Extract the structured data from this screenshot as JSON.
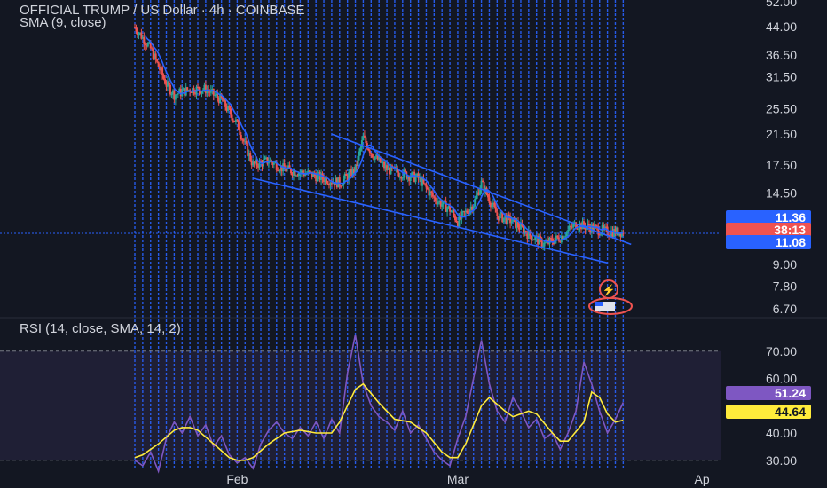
{
  "header": {
    "title": "OFFICIAL TRUMP / US Dollar · 4h · COINBASE",
    "indicator": "SMA (9, close)",
    "rsi_label": "RSI (14, close, SMA, 14, 2)"
  },
  "badges": {
    "price_upper": "11.36",
    "countdown": "38:13",
    "price_lower": "11.08",
    "rsi_value": "51.24",
    "rsi_sma_value": "44.64"
  },
  "colors": {
    "background": "#131722",
    "grid_dotted": "#2962ff",
    "up": "#26a69a",
    "down": "#ef5350",
    "sma": "#2962ff",
    "channel": "#2962ff",
    "rsi": "#7e57c2",
    "rsi_sma": "#ffeb3b"
  },
  "chart_data": [
    {
      "type": "candlestick",
      "title": "OFFICIAL TRUMP / US Dollar · 4h · COINBASE",
      "y_scale": "log",
      "y_ticks": [
        52.0,
        44.0,
        36.5,
        31.5,
        25.5,
        21.5,
        17.5,
        14.5,
        11.36,
        9.0,
        7.8,
        6.7
      ],
      "x_ticks": [
        "Feb",
        "Mar",
        "Ap"
      ],
      "x_range": [
        "2025-01-19",
        "2025-04-02"
      ],
      "close_path": [
        [
          "2025-01-19",
          44.0
        ],
        [
          "2025-01-21",
          38.0
        ],
        [
          "2025-01-23",
          30.0
        ],
        [
          "2025-01-24",
          28.0
        ],
        [
          "2025-01-26",
          29.0
        ],
        [
          "2025-01-28",
          29.0
        ],
        [
          "2025-01-30",
          27.0
        ],
        [
          "2025-02-01",
          23.0
        ],
        [
          "2025-02-02",
          20.0
        ],
        [
          "2025-02-03",
          17.5
        ],
        [
          "2025-02-05",
          18.0
        ],
        [
          "2025-02-07",
          17.0
        ],
        [
          "2025-02-10",
          16.5
        ],
        [
          "2025-02-12",
          16.0
        ],
        [
          "2025-02-14",
          15.5
        ],
        [
          "2025-02-16",
          17.0
        ],
        [
          "2025-02-17",
          21.0
        ],
        [
          "2025-02-18",
          19.0
        ],
        [
          "2025-02-20",
          17.0
        ],
        [
          "2025-02-22",
          16.5
        ],
        [
          "2025-02-24",
          16.0
        ],
        [
          "2025-02-26",
          14.0
        ],
        [
          "2025-02-28",
          13.0
        ],
        [
          "2025-03-01",
          12.0
        ],
        [
          "2025-03-03",
          13.5
        ],
        [
          "2025-03-04",
          15.5
        ],
        [
          "2025-03-06",
          12.5
        ],
        [
          "2025-03-08",
          12.0
        ],
        [
          "2025-03-10",
          11.0
        ],
        [
          "2025-03-12",
          10.3
        ],
        [
          "2025-03-14",
          10.8
        ],
        [
          "2025-03-16",
          11.8
        ],
        [
          "2025-03-18",
          11.5
        ],
        [
          "2025-03-20",
          11.2
        ]
      ],
      "sma": {
        "name": "SMA (9, close)",
        "period": 9
      },
      "channel": {
        "upper": [
          [
            "2025-02-13",
            21.5
          ],
          [
            "2025-03-23",
            10.3
          ]
        ],
        "lower": [
          [
            "2025-02-03",
            16.0
          ],
          [
            "2025-03-20",
            9.1
          ]
        ]
      },
      "last_price": 11.08
    },
    {
      "type": "line",
      "title": "RSI (14, close, SMA, 14, 2)",
      "y_ticks": [
        70.0,
        60.0,
        50.0,
        40.0,
        30.0
      ],
      "ylim": [
        27,
        80
      ],
      "band": [
        30,
        70
      ],
      "x_ticks": [
        "Feb",
        "Mar",
        "Ap"
      ],
      "series": [
        {
          "name": "RSI",
          "points": [
            [
              "2025-01-19",
              30
            ],
            [
              "2025-01-20",
              28
            ],
            [
              "2025-01-21",
              33
            ],
            [
              "2025-01-22",
              26
            ],
            [
              "2025-01-23",
              38
            ],
            [
              "2025-01-24",
              44
            ],
            [
              "2025-01-25",
              40
            ],
            [
              "2025-01-26",
              46
            ],
            [
              "2025-01-27",
              39
            ],
            [
              "2025-01-28",
              43
            ],
            [
              "2025-01-29",
              35
            ],
            [
              "2025-01-30",
              39
            ],
            [
              "2025-01-31",
              32
            ],
            [
              "2025-02-01",
              29
            ],
            [
              "2025-02-02",
              31
            ],
            [
              "2025-02-03",
              27
            ],
            [
              "2025-02-04",
              36
            ],
            [
              "2025-02-05",
              41
            ],
            [
              "2025-02-06",
              44
            ],
            [
              "2025-02-07",
              40
            ],
            [
              "2025-02-08",
              38
            ],
            [
              "2025-02-09",
              42
            ],
            [
              "2025-02-10",
              39
            ],
            [
              "2025-02-11",
              44
            ],
            [
              "2025-02-12",
              38
            ],
            [
              "2025-02-13",
              45
            ],
            [
              "2025-02-14",
              40
            ],
            [
              "2025-02-15",
              62
            ],
            [
              "2025-02-16",
              76
            ],
            [
              "2025-02-17",
              58
            ],
            [
              "2025-02-18",
              50
            ],
            [
              "2025-02-19",
              46
            ],
            [
              "2025-02-20",
              44
            ],
            [
              "2025-02-21",
              41
            ],
            [
              "2025-02-22",
              48
            ],
            [
              "2025-02-23",
              40
            ],
            [
              "2025-02-24",
              43
            ],
            [
              "2025-02-25",
              38
            ],
            [
              "2025-02-26",
              33
            ],
            [
              "2025-02-27",
              30
            ],
            [
              "2025-02-28",
              28
            ],
            [
              "2025-03-01",
              38
            ],
            [
              "2025-03-02",
              46
            ],
            [
              "2025-03-03",
              60
            ],
            [
              "2025-03-04",
              74
            ],
            [
              "2025-03-05",
              58
            ],
            [
              "2025-03-06",
              48
            ],
            [
              "2025-03-07",
              44
            ],
            [
              "2025-03-08",
              53
            ],
            [
              "2025-03-09",
              48
            ],
            [
              "2025-03-10",
              42
            ],
            [
              "2025-03-11",
              45
            ],
            [
              "2025-03-12",
              38
            ],
            [
              "2025-03-13",
              40
            ],
            [
              "2025-03-14",
              34
            ],
            [
              "2025-03-15",
              40
            ],
            [
              "2025-03-16",
              48
            ],
            [
              "2025-03-17",
              66
            ],
            [
              "2025-03-18",
              58
            ],
            [
              "2025-03-19",
              48
            ],
            [
              "2025-03-20",
              40
            ],
            [
              "2025-03-21",
              45
            ],
            [
              "2025-03-22",
              51.24
            ]
          ]
        },
        {
          "name": "RSI SMA",
          "points": [
            [
              "2025-01-19",
              31
            ],
            [
              "2025-01-20",
              32
            ],
            [
              "2025-01-22",
              36
            ],
            [
              "2025-01-24",
              41
            ],
            [
              "2025-01-25",
              42
            ],
            [
              "2025-01-26",
              42
            ],
            [
              "2025-01-27",
              41
            ],
            [
              "2025-01-29",
              36
            ],
            [
              "2025-01-31",
              31
            ],
            [
              "2025-02-01",
              30
            ],
            [
              "2025-02-02",
              30
            ],
            [
              "2025-02-03",
              31
            ],
            [
              "2025-02-05",
              36
            ],
            [
              "2025-02-07",
              40
            ],
            [
              "2025-02-09",
              41
            ],
            [
              "2025-02-11",
              40
            ],
            [
              "2025-02-13",
              40
            ],
            [
              "2025-02-14",
              44
            ],
            [
              "2025-02-16",
              56
            ],
            [
              "2025-02-17",
              58
            ],
            [
              "2025-02-19",
              51
            ],
            [
              "2025-02-21",
              45
            ],
            [
              "2025-02-23",
              44
            ],
            [
              "2025-02-25",
              40
            ],
            [
              "2025-02-27",
              33
            ],
            [
              "2025-02-28",
              31
            ],
            [
              "2025-03-01",
              31
            ],
            [
              "2025-03-02",
              36
            ],
            [
              "2025-03-04",
              50
            ],
            [
              "2025-03-05",
              53
            ],
            [
              "2025-03-07",
              48
            ],
            [
              "2025-03-08",
              46
            ],
            [
              "2025-03-10",
              48
            ],
            [
              "2025-03-11",
              47
            ],
            [
              "2025-03-13",
              40
            ],
            [
              "2025-03-14",
              37
            ],
            [
              "2025-03-15",
              37
            ],
            [
              "2025-03-17",
              44
            ],
            [
              "2025-03-18",
              55
            ],
            [
              "2025-03-19",
              53
            ],
            [
              "2025-03-20",
              47
            ],
            [
              "2025-03-21",
              44
            ],
            [
              "2025-03-22",
              44.64
            ]
          ]
        }
      ],
      "last_values": [
        51.24,
        44.64
      ]
    }
  ]
}
